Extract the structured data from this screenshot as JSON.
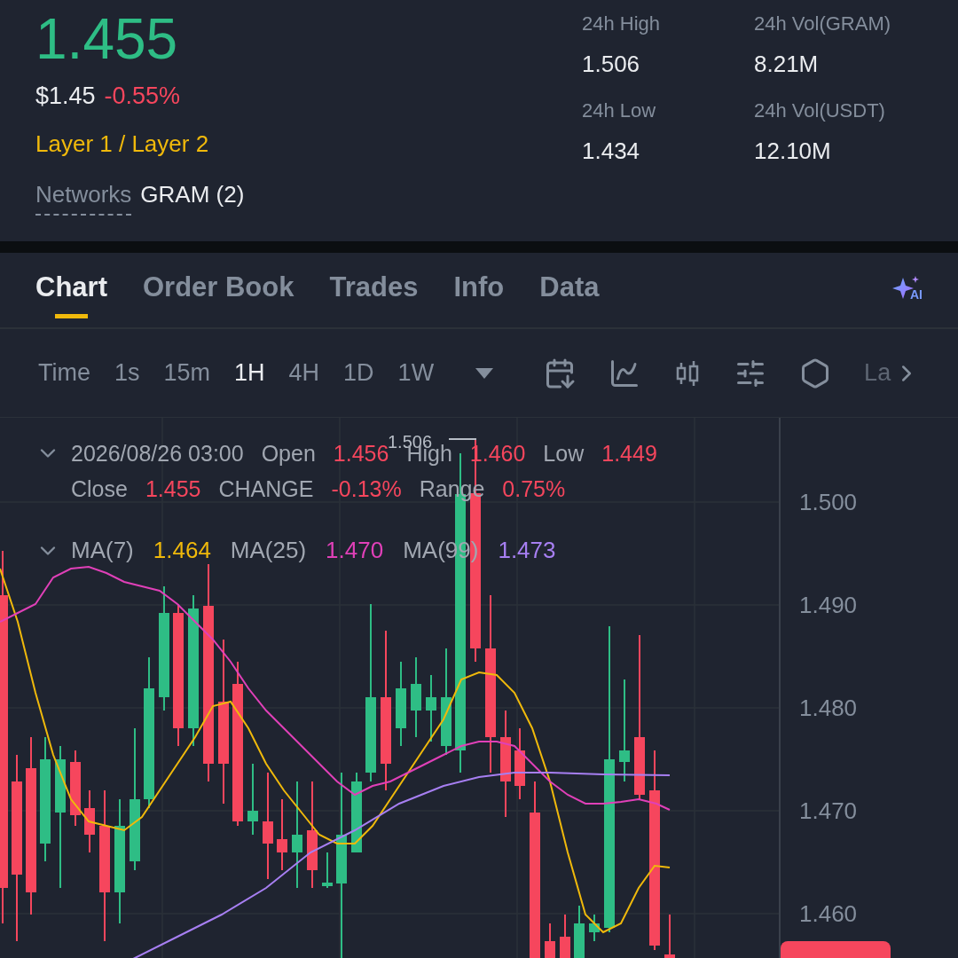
{
  "ticker": {
    "last_price": "1.455",
    "usd_price": "$1.45",
    "change": "-0.55%",
    "category": "Layer 1 / Layer 2",
    "networks_label": "Networks",
    "networks_value": "GRAM (2)"
  },
  "stats": [
    {
      "label": "24h High",
      "value": "1.506"
    },
    {
      "label": "24h Vol(GRAM)",
      "value": "8.21M"
    },
    {
      "label": "24h Low",
      "value": "1.434"
    },
    {
      "label": "24h Vol(USDT)",
      "value": "12.10M"
    }
  ],
  "tabs": [
    {
      "label": "Chart",
      "selected": true
    },
    {
      "label": "Order Book",
      "selected": false
    },
    {
      "label": "Trades",
      "selected": false
    },
    {
      "label": "Info",
      "selected": false
    },
    {
      "label": "Data",
      "selected": false
    }
  ],
  "intervals": [
    {
      "label": "Time",
      "selected": false
    },
    {
      "label": "1s",
      "selected": false
    },
    {
      "label": "15m",
      "selected": false
    },
    {
      "label": "1H",
      "selected": true
    },
    {
      "label": "4H",
      "selected": false
    },
    {
      "label": "1D",
      "selected": false
    },
    {
      "label": "1W",
      "selected": false
    }
  ],
  "toolbar_cut_label": "La",
  "ai_label": "AI",
  "chart": {
    "peak_label": "1.506",
    "date": "2026/08/26 03:00",
    "ohlc": [
      {
        "label": "Open",
        "value": "1.456"
      },
      {
        "label": "High",
        "value": "1.460"
      },
      {
        "label": "Low",
        "value": "1.449"
      },
      {
        "label": "Close",
        "value": "1.455"
      },
      {
        "label": "CHANGE",
        "value": "-0.13%"
      },
      {
        "label": "Range",
        "value": "0.75%"
      }
    ],
    "moving_averages": [
      {
        "name": "MA(7)",
        "value": "1.464",
        "color": "#f0b90b"
      },
      {
        "name": "MA(25)",
        "value": "1.470",
        "color": "#e040b8"
      },
      {
        "name": "MA(99)",
        "value": "1.473",
        "color": "#a77ff2"
      }
    ],
    "price_ticks": [
      "1.500",
      "1.490",
      "1.480",
      "1.470",
      "1.460"
    ]
  }
}
